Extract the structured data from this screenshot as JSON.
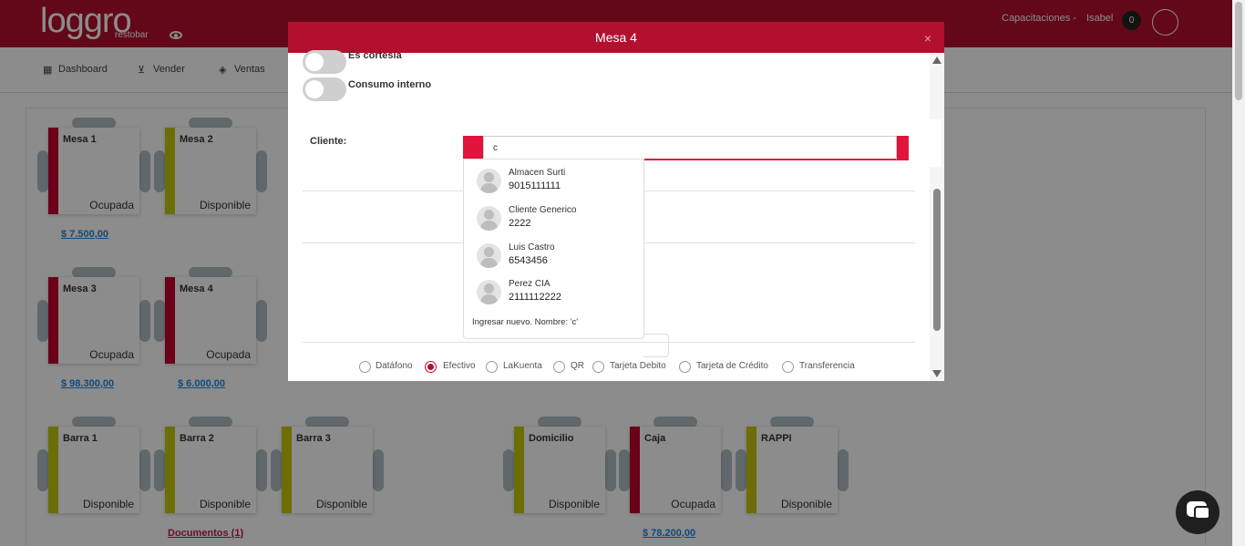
{
  "app": {
    "logo": "loggro",
    "logo_sub": "restobar",
    "company": "Capacitaciones -",
    "user": "Isabel",
    "notifications": "0"
  },
  "nav": {
    "items": [
      {
        "label": "Dashboard",
        "icon": "dashboard-icon"
      },
      {
        "label": "Vender",
        "icon": "cart-icon"
      },
      {
        "label": "Ventas",
        "icon": "tag-icon"
      }
    ]
  },
  "tables": [
    {
      "name": "Mesa 1",
      "status": "Ocupada",
      "amount": "$ 7.500,00",
      "color": "#c2002f"
    },
    {
      "name": "Mesa 2",
      "status": "Disponible",
      "amount": "",
      "color": "#c6c60a"
    },
    {
      "name": "Mesa 3",
      "status": "Ocupada",
      "amount": "$ 98.300,00",
      "color": "#c2002f"
    },
    {
      "name": "Mesa 4",
      "status": "Ocupada",
      "amount": "$ 6.000,00",
      "color": "#c2002f"
    },
    {
      "name": "Barra 1",
      "status": "Disponible",
      "amount": "",
      "color": "#c6c60a"
    },
    {
      "name": "Barra 2",
      "status": "Disponible",
      "link": "Documentos (1)",
      "color": "#c6c60a"
    },
    {
      "name": "Barra 3",
      "status": "Disponible",
      "amount": "",
      "color": "#c6c60a"
    },
    {
      "name": "Domicilio",
      "status": "Disponible",
      "amount": "",
      "color": "#c6c60a"
    },
    {
      "name": "Caja",
      "status": "Ocupada",
      "amount": "$ 78.200,00",
      "color": "#c2002f"
    },
    {
      "name": "RAPPI",
      "status": "Disponible",
      "amount": "",
      "color": "#c6c60a"
    }
  ],
  "modal": {
    "title": "Mesa 4",
    "close": "×",
    "toggles": [
      {
        "label": "Es cortesía",
        "on": false
      },
      {
        "label": "Consumo interno",
        "on": false
      }
    ],
    "client_label": "Cliente:",
    "client_value": "c",
    "payment_methods": [
      {
        "label": "Datáfono",
        "selected": false
      },
      {
        "label": "Efectivo",
        "selected": true
      },
      {
        "label": "LaKuenta",
        "selected": false
      },
      {
        "label": "QR",
        "selected": false
      },
      {
        "label": "Tarjeta Debito",
        "selected": false
      },
      {
        "label": "Tarjeta de Crédito",
        "selected": false
      },
      {
        "label": "Transferencia",
        "selected": false
      }
    ]
  },
  "dropdown": {
    "clients": [
      {
        "name": "Almacen Surti",
        "phone": "9015111111"
      },
      {
        "name": "Cliente Generico",
        "phone": "2222"
      },
      {
        "name": "Luis Castro",
        "phone": "6543456"
      },
      {
        "name": "Perez CIA",
        "phone": "2111112222"
      }
    ],
    "new_entry": "Ingresar nuevo. Nombre: 'c'"
  },
  "colors": {
    "brand": "#b3102f",
    "accent": "#e0143c",
    "occupied": "#c2002f",
    "available": "#c6c60a"
  }
}
